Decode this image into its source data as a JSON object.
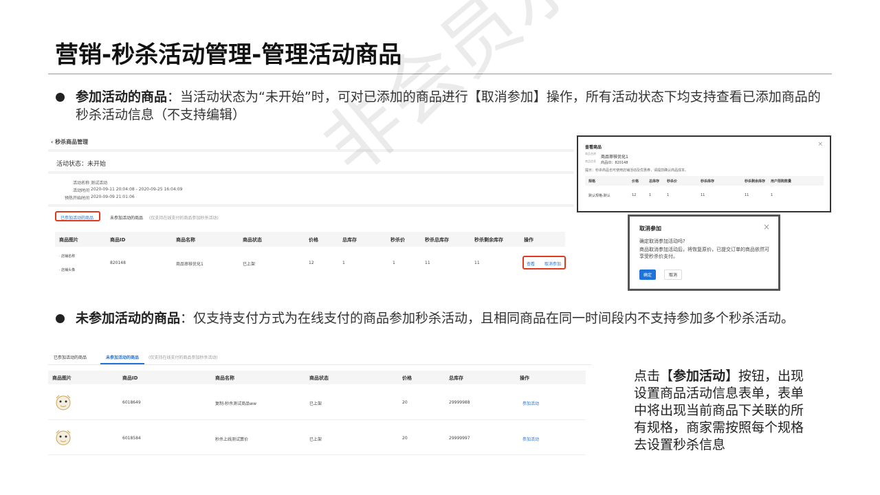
{
  "slide": {
    "title": "营销-秒杀活动管理-管理活动商品",
    "bullet1_bold": "参加活动的商品",
    "bullet1_text": "：当活动状态为“未开始”时，可对已添加的商品进行【取消参加】操作，所有活动状态下均支持查看已添加商品的秒杀活动信息（不支持编辑）",
    "bullet2_bold": "未参加活动的商品",
    "bullet2_text": "：仅支持支付方式为在线支付的商品参加秒杀活动，且相同商品在同一时间段内不支持参加多个秒杀活动。",
    "note_pre": "点击【",
    "note_bold": "参加活动",
    "note_post": "】按钮，出现设置商品活动信息表单，表单中将出现当前商品下关联的所有规格，商家需按照每个规格去设置秒杀信息",
    "watermark": "非会员水印"
  },
  "shot1": {
    "back": "‹ 秒杀商品管理",
    "status_label": "活动状态：未开始",
    "info": [
      {
        "k": "活动名称",
        "v": "测试活动"
      },
      {
        "k": "活动时间",
        "v": "2020-09-11 20:04:08 - 2020-09-25 16:04:09"
      },
      {
        "k": "预热开始时间",
        "v": "2020-09-09 21:01:06"
      }
    ],
    "tab_active": "已参加活动的商品",
    "tab_other": "未参加活动的商品",
    "tab_hint": "(仅支持在线支付的商品参加秒杀活动)",
    "headers": [
      "商品图片",
      "商品ID",
      "商品名称",
      "商品状态",
      "价格",
      "总库存",
      "秒杀价",
      "秒杀总库存",
      "秒杀剩余库存",
      "操作"
    ],
    "row": {
      "img1": "· 店铺名称",
      "img2": "· 店铺头像",
      "id": "820148",
      "name": "商品审核优化1",
      "status": "已上架",
      "price": "12",
      "stock": "1",
      "seckill_price": "1",
      "seckill_stock": "11",
      "seckill_left": "11",
      "op_view": "查看",
      "op_cancel": "取消参加"
    }
  },
  "view_dialog": {
    "title": "查看商品",
    "close": "×",
    "name_label": "商品名称",
    "name": "商品审核优化1",
    "id_label": "商品信息",
    "id": "商品ID：820148",
    "tip": "提示：秒杀商品也可使用店铺活动及优惠券，请提前确认商品成本。",
    "headers": [
      "规格",
      "价格",
      "总库存",
      "秒杀价",
      "秒杀库存",
      "秒杀剩余库存",
      "用户限购数量"
    ],
    "row": [
      "默认规格-默认",
      "12",
      "1",
      "1",
      "11",
      "11",
      "1"
    ]
  },
  "cancel_dialog": {
    "title": "取消参加",
    "close": "×",
    "question": "确定取消参加活动吗?",
    "desc": "商品取消参加活动后，将恢复原价，已提交订单的商品依然可享受秒杀价支付。",
    "confirm": "确定",
    "cancel": "取消"
  },
  "shot2": {
    "tab1": "已参加活动的商品",
    "tab2": "未参加活动的商品",
    "tab_hint": "(仅支持在线支付的商品参加秒杀活动)",
    "headers": [
      "商品图片",
      "商品ID",
      "商品名称",
      "商品状态",
      "价格",
      "总库存",
      "操作"
    ],
    "rows": [
      {
        "id": "6018649",
        "name": "复制-秒杀测试商品ww",
        "status": "已上架",
        "price": "20",
        "stock": "29999988",
        "op": "参加活动"
      },
      {
        "id": "6018584",
        "name": "秒杀上线测试算价",
        "status": "已上架",
        "price": "20",
        "stock": "29999997",
        "op": "参加活动"
      }
    ]
  }
}
